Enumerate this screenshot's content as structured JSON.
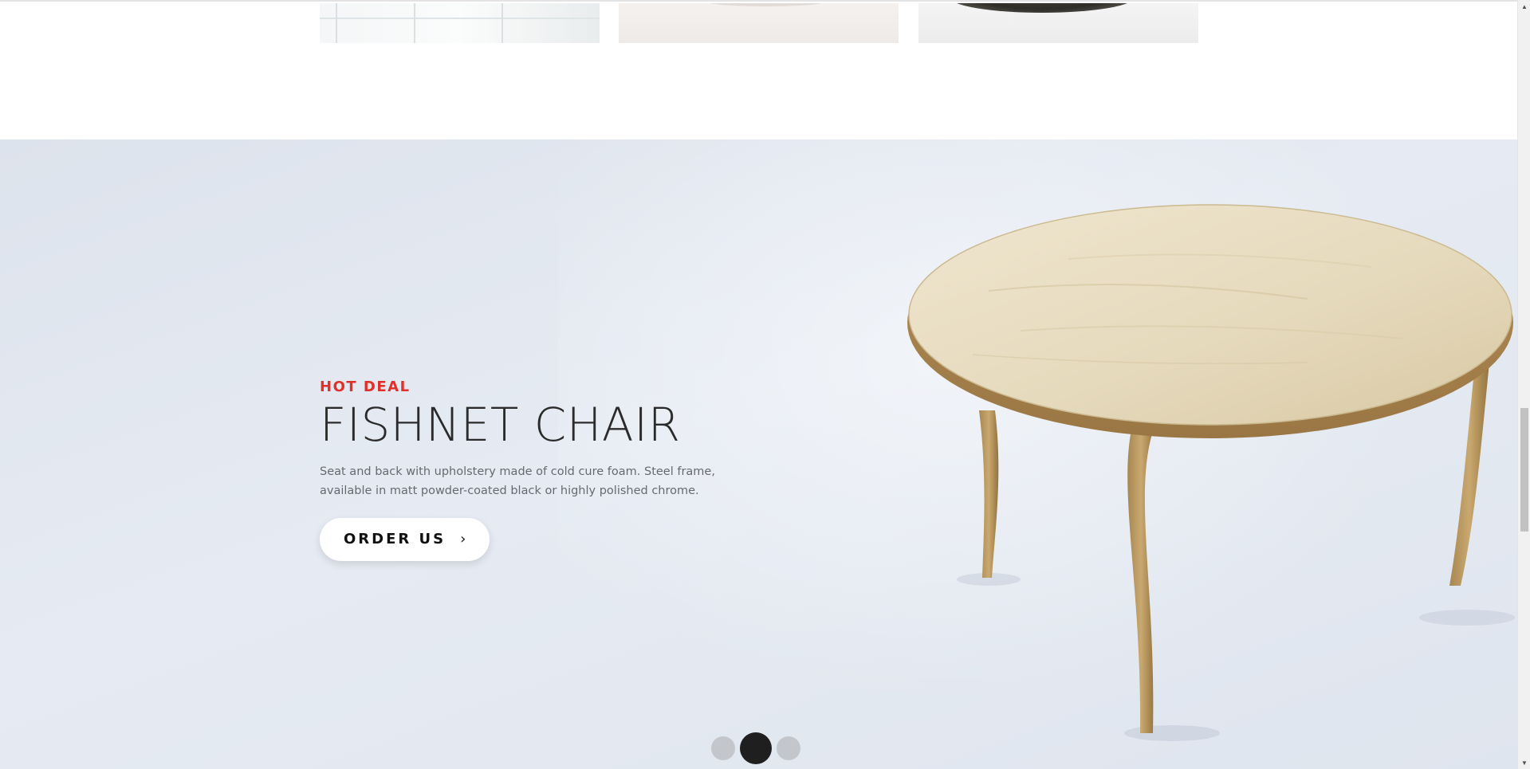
{
  "hero": {
    "eyebrow": "HOT DEAL",
    "title": "FISHNET CHAIR",
    "description_line1": "Seat and back with upholstery made of cold cure foam. Steel frame,",
    "description_line2": "available in matt powder-coated black or highly polished chrome.",
    "button_label": "ORDER US",
    "button_icon": "chevron-right-icon",
    "accent_color": "#e0302a"
  },
  "slider": {
    "dot_count": 3,
    "active_index": 1
  },
  "scrollbar": {
    "up_icon": "triangle-up-icon",
    "down_icon": "triangle-down-icon"
  }
}
